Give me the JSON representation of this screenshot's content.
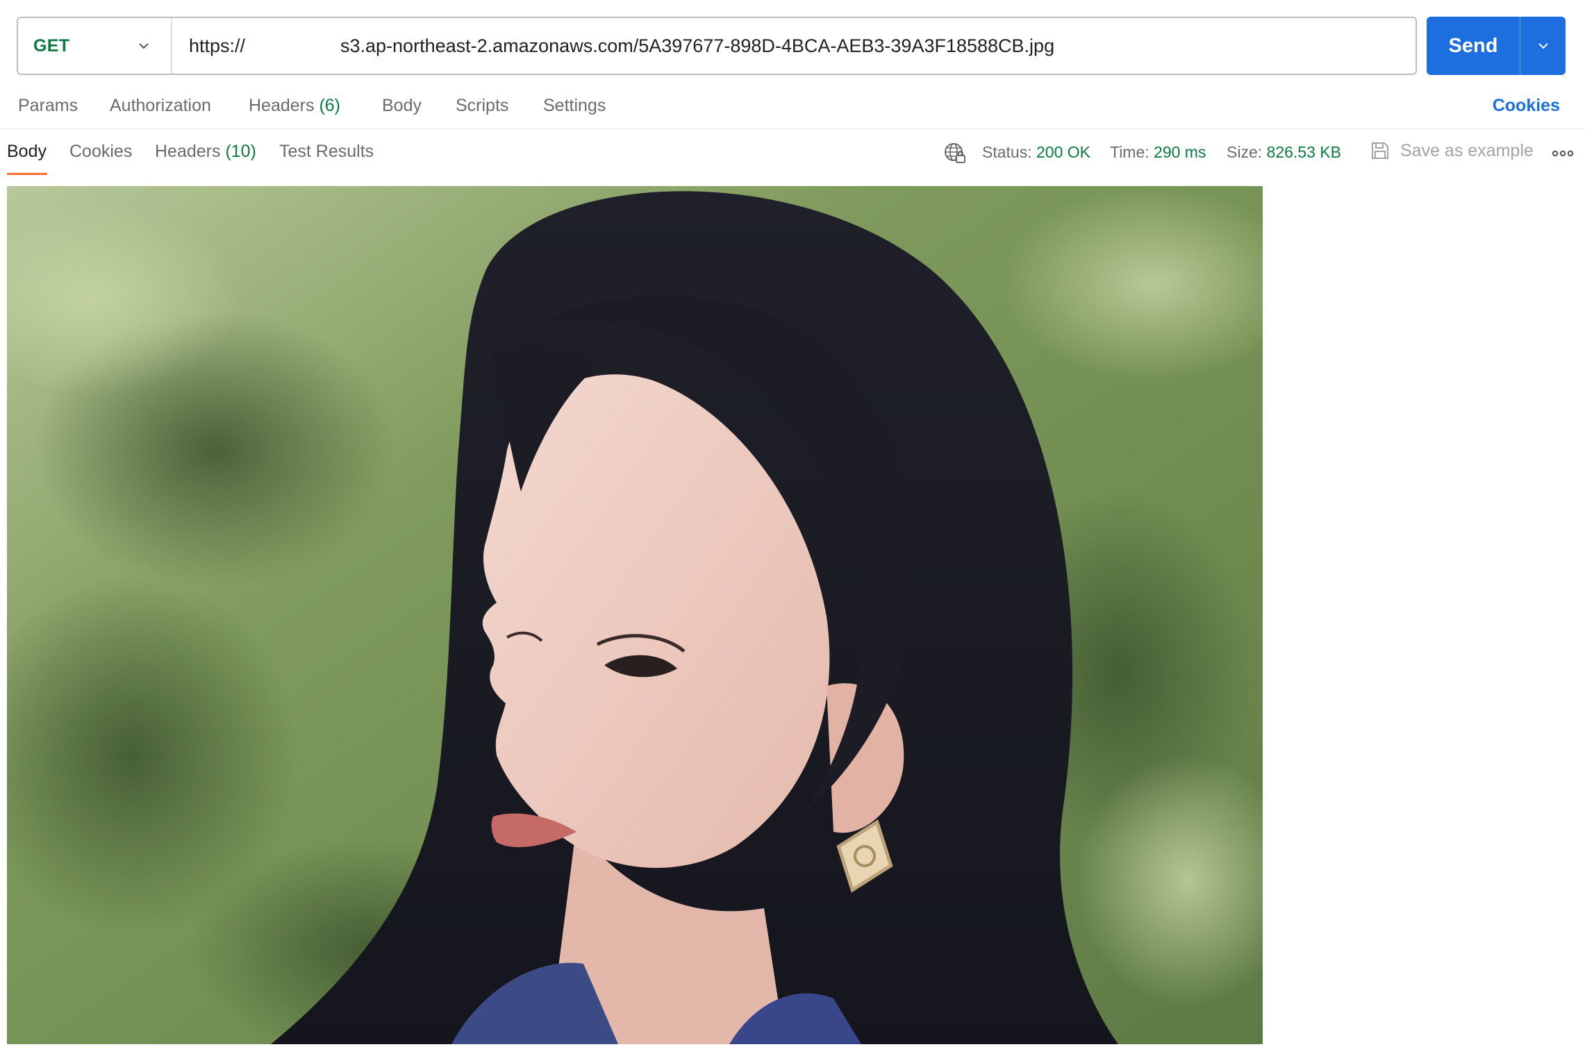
{
  "request": {
    "method": "GET",
    "url_prefix": "https://",
    "url_visible": "s3.ap-northeast-2.amazonaws.com/5A397677-898D-4BCA-AEB3-39A3F18588CB.jpg",
    "send_label": "Send"
  },
  "request_tabs": [
    {
      "label": "Params",
      "count": ""
    },
    {
      "label": "Authorization",
      "count": ""
    },
    {
      "label": "Headers",
      "count": "(6)"
    },
    {
      "label": "Body",
      "count": ""
    },
    {
      "label": "Scripts",
      "count": ""
    },
    {
      "label": "Settings",
      "count": ""
    }
  ],
  "cookies_link": "Cookies",
  "response_tabs": [
    {
      "label": "Body",
      "count": ""
    },
    {
      "label": "Cookies",
      "count": ""
    },
    {
      "label": "Headers",
      "count": "(10)"
    },
    {
      "label": "Test Results",
      "count": ""
    }
  ],
  "response_meta": {
    "status_label": "Status:",
    "status_value": "200 OK",
    "time_label": "Time:",
    "time_value": "290 ms",
    "size_label": "Size:",
    "size_value": "826.53 KB"
  },
  "save_example_label": "Save as example",
  "colors": {
    "accent_blue": "#1d6fe0",
    "method_green": "#0b7a3e",
    "active_tab_underline": "#ff6c37"
  },
  "icons": [
    "chevron-down-icon",
    "globe-lock-icon",
    "save-icon",
    "more-options-icon"
  ]
}
